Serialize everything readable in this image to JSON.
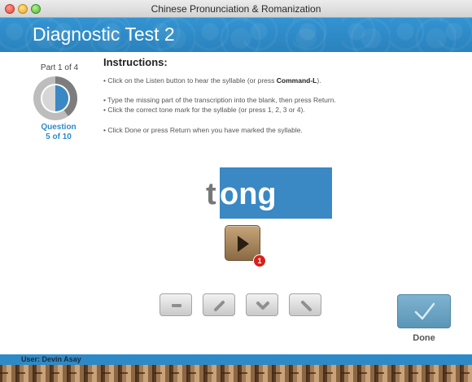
{
  "window": {
    "title": "Chinese Pronunciation & Romanization"
  },
  "header": {
    "title": "Diagnostic Test 2"
  },
  "progress": {
    "part_label": "Part 1 of 4",
    "question_label_line1": "Question",
    "question_label_line2": "5 of 10",
    "completed_fraction": 0.4
  },
  "instructions": {
    "title": "Instructions:",
    "line1_pre": "• Click on the Listen button to hear the syllable (or press ",
    "line1_key": "Command-L",
    "line1_post": ").",
    "line2": "• Type the missing part of the transcription into the blank, then press Return.",
    "line3": "• Click the correct tone mark for the syllable (or press 1, 2, 3 or 4).",
    "line4": "• Click Done or press  Return  when you have marked the syllable."
  },
  "syllable": {
    "initial": "t",
    "final": "ong"
  },
  "listen": {
    "icon": "play-icon",
    "badge_count": "1"
  },
  "tones": [
    {
      "name": "tone-1-button",
      "icon": "level-tone-icon"
    },
    {
      "name": "tone-2-button",
      "icon": "rising-tone-icon"
    },
    {
      "name": "tone-3-button",
      "icon": "dipping-tone-icon"
    },
    {
      "name": "tone-4-button",
      "icon": "falling-tone-icon"
    }
  ],
  "done": {
    "label": "Done",
    "icon": "checkmark-icon"
  },
  "footer": {
    "user_label": "User: Devin Asay"
  },
  "colors": {
    "accent": "#2e8ac6",
    "syllable_box": "#3a88c4",
    "badge": "#d8201b"
  }
}
